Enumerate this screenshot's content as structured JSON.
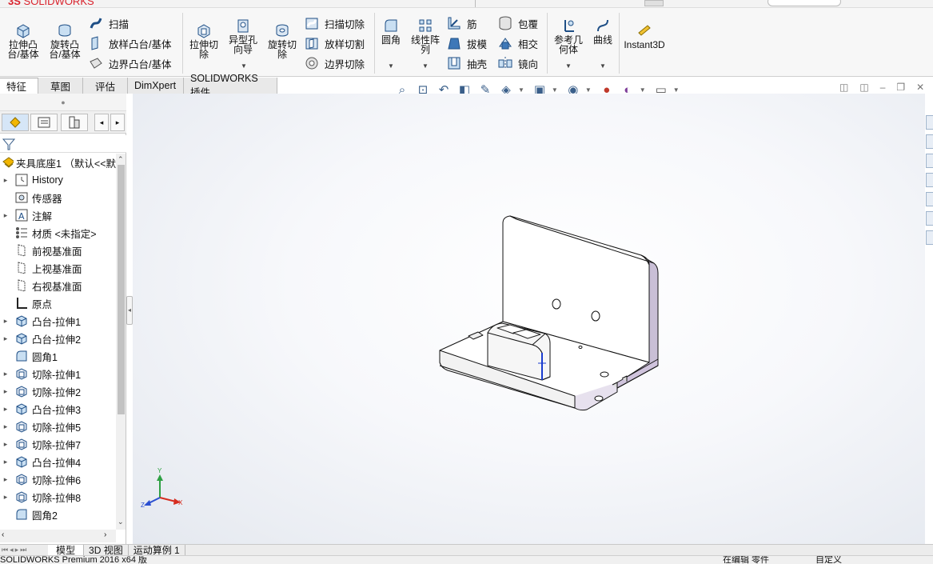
{
  "app": {
    "brand_ds": "3S",
    "brand_name": "SOLIDWORKS"
  },
  "ribbon": {
    "large": [
      {
        "label": "拉伸凸\n台/基体"
      },
      {
        "label": "旋转凸\n台/基体"
      },
      {
        "label": "拉伸切\n除"
      },
      {
        "label": "异型孔\n向导"
      },
      {
        "label": "旋转切\n除"
      },
      {
        "label": "圆角"
      },
      {
        "label": "线性阵\n列"
      },
      {
        "label": "参考几\n何体"
      },
      {
        "label": "曲线"
      },
      {
        "label": "Instant3D"
      }
    ],
    "small": [
      {
        "label": "扫描"
      },
      {
        "label": "放样凸台/基体"
      },
      {
        "label": "边界凸台/基体"
      },
      {
        "label": "扫描切除"
      },
      {
        "label": "放样切割"
      },
      {
        "label": "边界切除"
      },
      {
        "label": "筋"
      },
      {
        "label": "拔模"
      },
      {
        "label": "抽壳"
      },
      {
        "label": "包覆"
      },
      {
        "label": "相交"
      },
      {
        "label": "镜向"
      }
    ]
  },
  "tabs": [
    {
      "label": "特征",
      "active": true
    },
    {
      "label": "草图"
    },
    {
      "label": "评估"
    },
    {
      "label": "DimXpert"
    },
    {
      "label": "SOLIDWORKS 插件"
    }
  ],
  "tree": {
    "root": "夹具底座1 （默认<<默",
    "items": [
      {
        "label": "History",
        "icon": "history-icon",
        "expand": true
      },
      {
        "label": "传感器",
        "icon": "sensor-icon",
        "expand": false
      },
      {
        "label": "注解",
        "icon": "annotation-icon",
        "expand": true
      },
      {
        "label": "材质 <未指定>",
        "icon": "material-icon",
        "expand": false
      },
      {
        "label": "前视基准面",
        "icon": "plane-icon",
        "expand": false
      },
      {
        "label": "上视基准面",
        "icon": "plane-icon",
        "expand": false
      },
      {
        "label": "右视基准面",
        "icon": "plane-icon",
        "expand": false
      },
      {
        "label": "原点",
        "icon": "origin-icon",
        "expand": false
      },
      {
        "label": "凸台-拉伸1",
        "icon": "boss-extrude-icon",
        "expand": true
      },
      {
        "label": "凸台-拉伸2",
        "icon": "boss-extrude-icon",
        "expand": true
      },
      {
        "label": "圆角1",
        "icon": "fillet-icon",
        "expand": false
      },
      {
        "label": "切除-拉伸1",
        "icon": "cut-extrude-icon",
        "expand": true
      },
      {
        "label": "切除-拉伸2",
        "icon": "cut-extrude-icon",
        "expand": true
      },
      {
        "label": "凸台-拉伸3",
        "icon": "boss-extrude-icon",
        "expand": true
      },
      {
        "label": "切除-拉伸5",
        "icon": "cut-extrude-icon",
        "expand": true
      },
      {
        "label": "切除-拉伸7",
        "icon": "cut-extrude-icon",
        "expand": true
      },
      {
        "label": "凸台-拉伸4",
        "icon": "boss-extrude-icon",
        "expand": true
      },
      {
        "label": "切除-拉伸6",
        "icon": "cut-extrude-icon",
        "expand": true
      },
      {
        "label": "切除-拉伸8",
        "icon": "cut-extrude-icon",
        "expand": true
      },
      {
        "label": "圆角2",
        "icon": "fillet-icon",
        "expand": false
      }
    ]
  },
  "triad": {
    "x": "X",
    "y": "Y",
    "z": "Z"
  },
  "bottom_tabs": [
    {
      "label": "模型",
      "active": true
    },
    {
      "label": "3D 视图"
    },
    {
      "label": "运动算例 1"
    }
  ],
  "status": {
    "left": "SOLIDWORKS Premium 2016 x64 版",
    "mid": "在编辑 零件",
    "right": "自定义"
  }
}
